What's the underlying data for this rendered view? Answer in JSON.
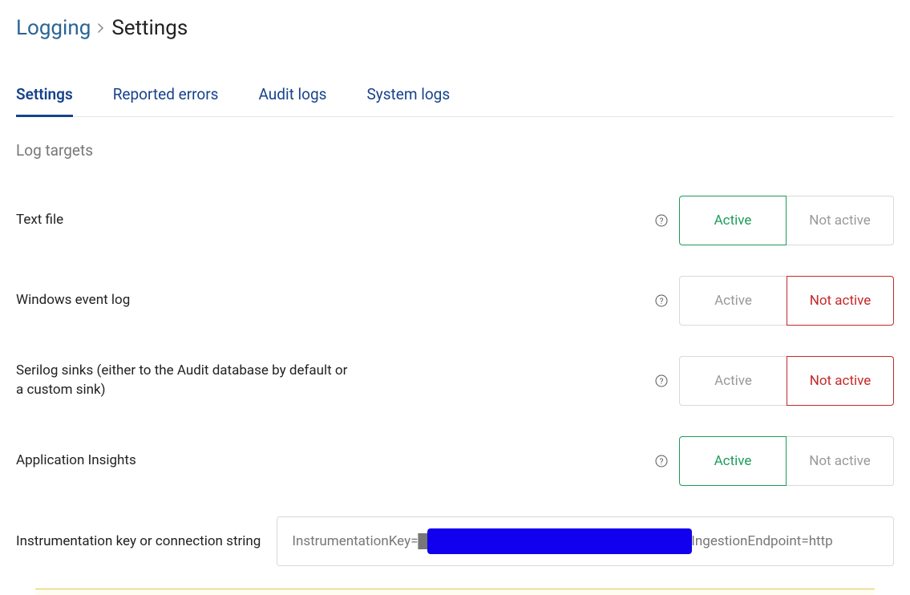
{
  "breadcrumb": {
    "parent": "Logging",
    "current": "Settings"
  },
  "tabs": [
    {
      "label": "Settings",
      "active": true
    },
    {
      "label": "Reported errors",
      "active": false
    },
    {
      "label": "Audit logs",
      "active": false
    },
    {
      "label": "System logs",
      "active": false
    }
  ],
  "section_title": "Log targets",
  "active_label": "Active",
  "not_active_label": "Not active",
  "targets": [
    {
      "label": "Text file",
      "state": "active"
    },
    {
      "label": "Windows event log",
      "state": "not_active"
    },
    {
      "label": "Serilog sinks (either to the Audit database by default or a custom sink)",
      "state": "not_active"
    },
    {
      "label": "Application Insights",
      "state": "active"
    }
  ],
  "instrumentation": {
    "label": "Instrumentation key or connection string",
    "value": "InstrumentationKey=████████████████████████████;IngestionEndpoint=http"
  }
}
